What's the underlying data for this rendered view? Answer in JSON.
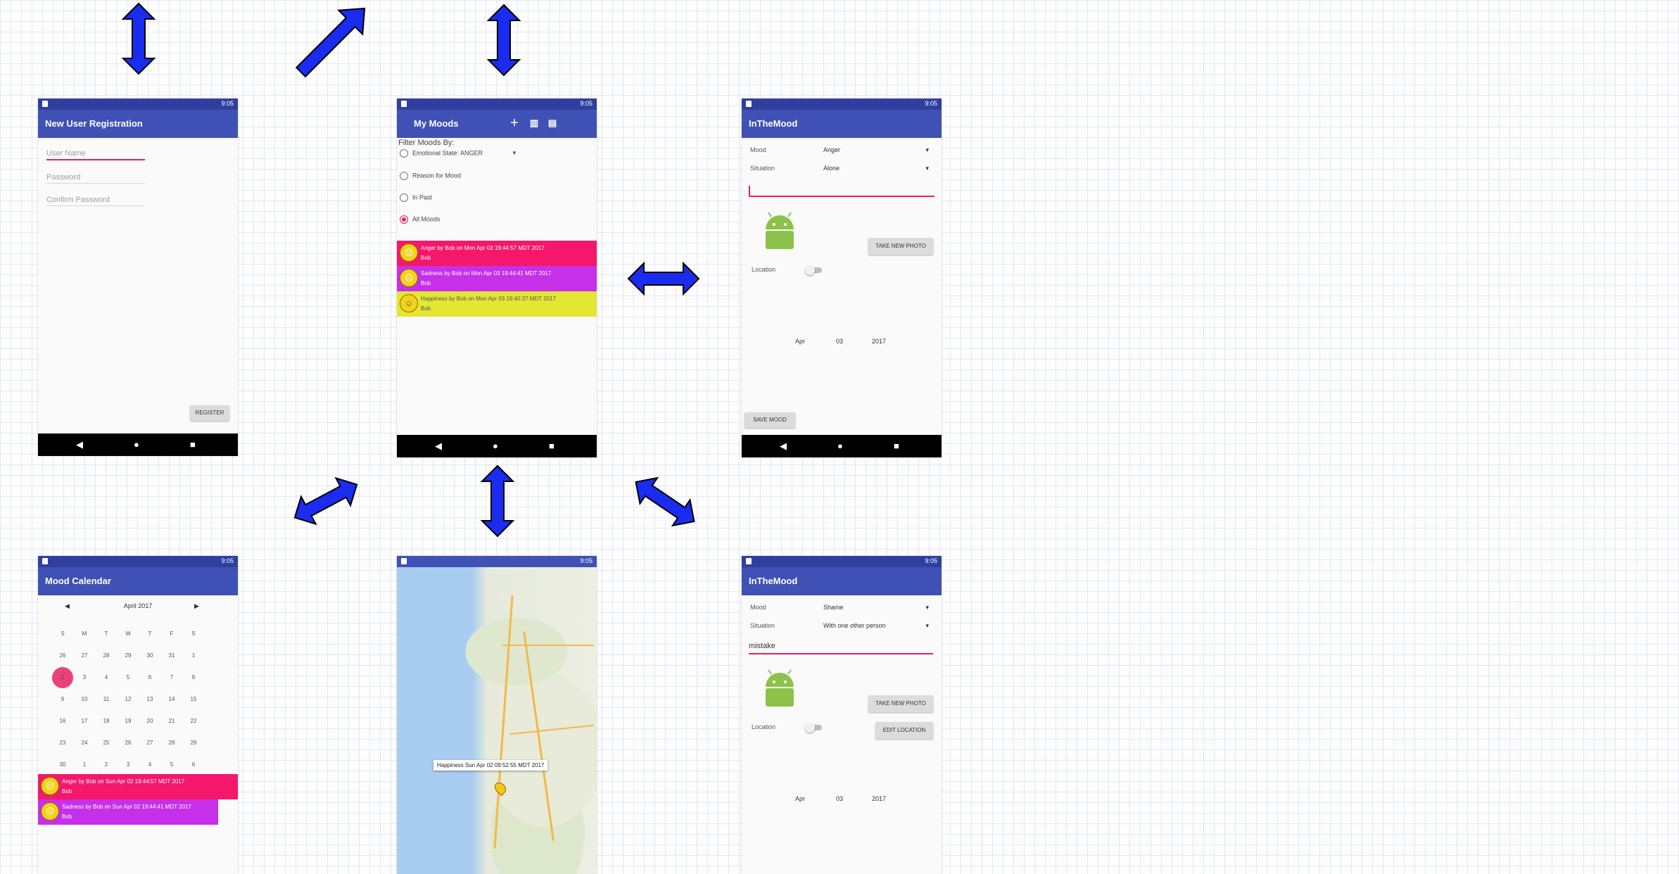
{
  "screens": {
    "registration": {
      "status_time": "9:05",
      "title": "New User Registration",
      "username_placeholder": "User Name",
      "password_placeholder": "Password",
      "confirm_placeholder": "Confirm Password",
      "register_button": "REGISTER"
    },
    "my_moods": {
      "status_time": "9:05",
      "title": "My Moods",
      "filter_label": "Filter Moods By:",
      "filters": [
        "Emotional State: ANGER",
        "Reason for Mood",
        "In Past",
        "All Moods"
      ],
      "moods": [
        {
          "face": "☹",
          "text": "Anger by Bob on Mon Apr 03 19:44:57 MDT 2017",
          "subtext": "Bob",
          "color": "#f5176c"
        },
        {
          "face": "☹",
          "text": "Sadness by Bob on Mon Apr 03 19:44:41 MDT 2017",
          "subtext": "Bob",
          "color": "#c530e8"
        },
        {
          "face": "☺",
          "text": "Happiness by Bob on Mon Apr 03 19:40:37 MDT 2017",
          "subtext": "Bob",
          "color": "#e4e634"
        }
      ]
    },
    "add_mood": {
      "status_time": "9:05",
      "title": "InTheMood",
      "mood_label": "Mood",
      "mood_value": "Anger",
      "situation_label": "Situation",
      "situation_value": "Alone",
      "take_photo_button": "TAKE NEW PHOTO",
      "location_label": "Location",
      "date_month": "Apr",
      "date_day": "03",
      "date_year": "2017",
      "save_button": "SAVE MOOD"
    },
    "calendar": {
      "status_time": "9:05",
      "title": "Mood Calendar",
      "month_label": "April 2017",
      "weekdays": [
        "S",
        "M",
        "T",
        "W",
        "T",
        "F",
        "S"
      ],
      "weeks": [
        [
          "26",
          "27",
          "28",
          "29",
          "30",
          "31",
          "1"
        ],
        [
          "2",
          "3",
          "4",
          "5",
          "6",
          "7",
          "8"
        ],
        [
          "9",
          "10",
          "11",
          "12",
          "13",
          "14",
          "15"
        ],
        [
          "16",
          "17",
          "18",
          "19",
          "20",
          "21",
          "22"
        ],
        [
          "23",
          "24",
          "25",
          "26",
          "27",
          "28",
          "29"
        ],
        [
          "30",
          "1",
          "2",
          "3",
          "4",
          "5",
          "6"
        ]
      ],
      "moods": [
        {
          "face": "☹",
          "text": "Anger by Bob on Sun Apr 02 19:44:57 MDT 2017",
          "subtext": "Bob",
          "color": "#f5176c"
        },
        {
          "face": "☹",
          "text": "Sadness by Bob on Sun Apr 02 19:44:41 MDT 2017",
          "subtext": "Bob",
          "color": "#c530e8"
        }
      ]
    },
    "map": {
      "status_time": "9:05",
      "pin_label": "Happiness Sun Apr 02 09:52:55 MDT 2017"
    },
    "edit_mood": {
      "status_time": "9:05",
      "title": "InTheMood",
      "mood_label": "Mood",
      "mood_value": "Shame",
      "situation_label": "Situation",
      "situation_value": "With one other person",
      "reason_value": "mistake",
      "take_photo_button": "TAKE NEW PHOTO",
      "location_label": "Location",
      "edit_location_button": "EDIT LOCATION",
      "date_month": "Apr",
      "date_day": "03",
      "date_year": "2017"
    }
  },
  "colors": {
    "primary": "#3f51b5",
    "primary_dark": "#303f9f",
    "accent": "#e91e63",
    "arrow": "#1a2cf0",
    "android_green": "#8bc34a"
  }
}
